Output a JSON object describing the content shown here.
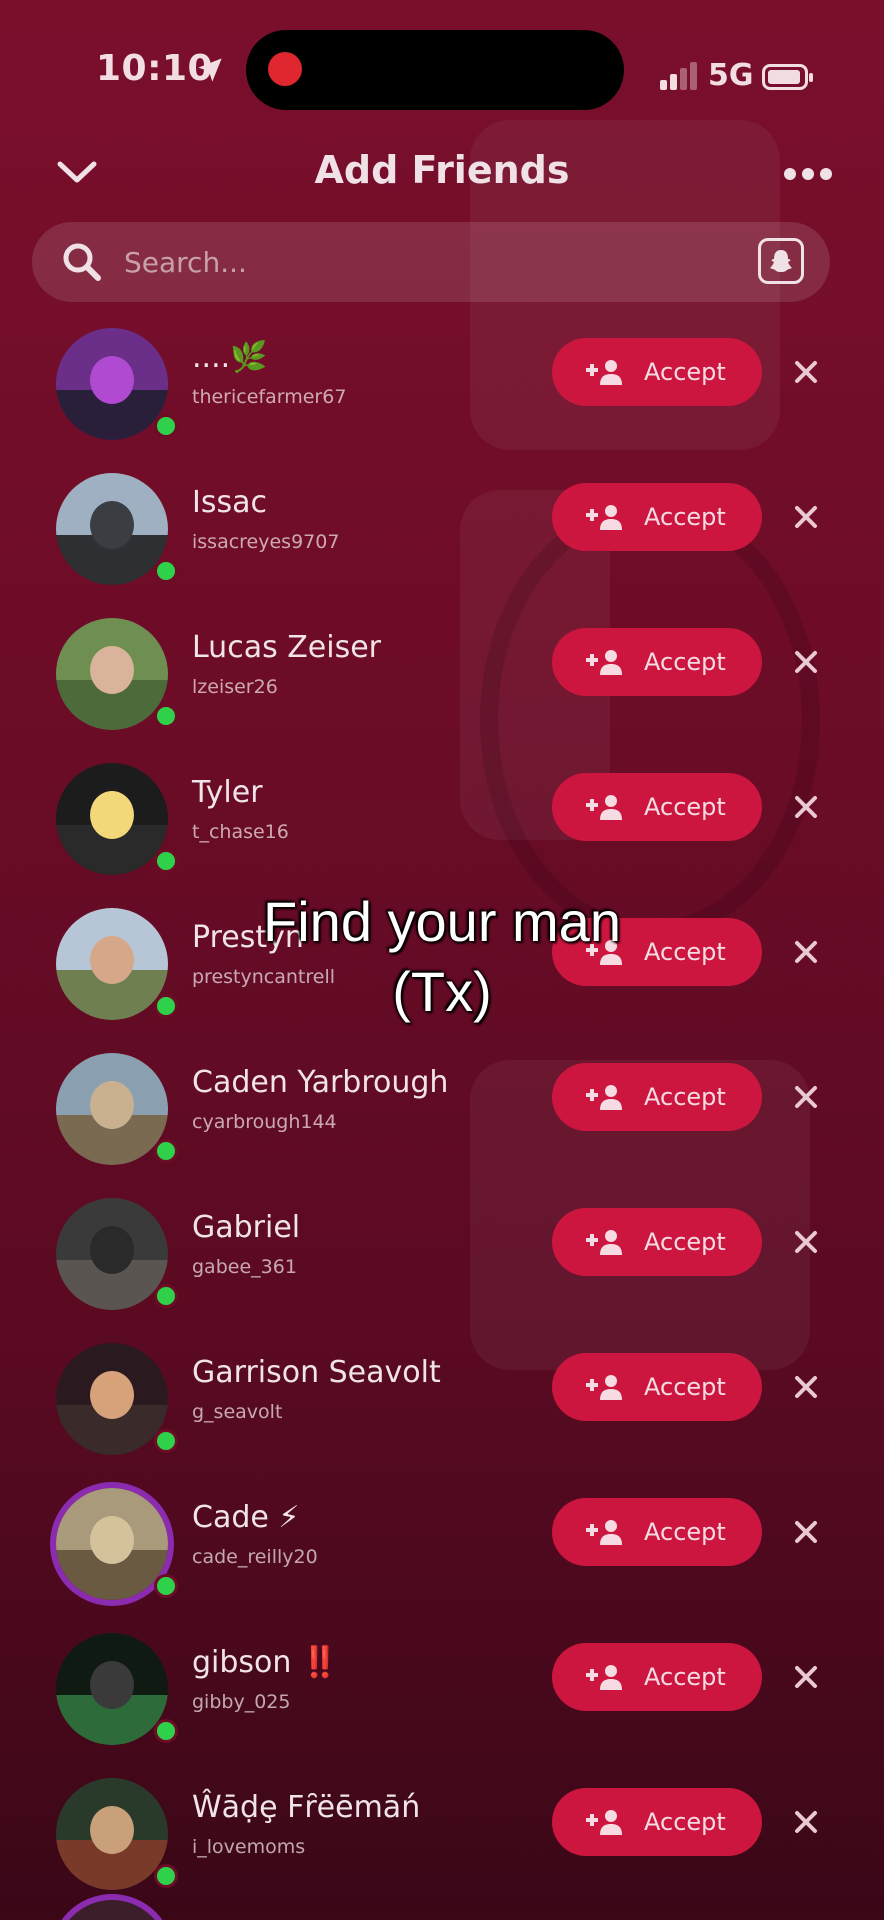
{
  "status_bar": {
    "time": "10:10",
    "network": "5G"
  },
  "header": {
    "title": "Add Friends"
  },
  "search": {
    "placeholder": "Search..."
  },
  "button_labels": {
    "accept": "Accept"
  },
  "caption": {
    "line1": "Find your man",
    "line2": "(Tx)"
  },
  "friends": [
    {
      "name": "....🌿",
      "username": "thericefarmer67",
      "avatar_colors": [
        "#6b2f8a",
        "#2a1f3a",
        "#b04ad0"
      ]
    },
    {
      "name": "Issac",
      "username": "issacreyes9707",
      "avatar_colors": [
        "#9fb0c2",
        "#2d2f33",
        "#3a3d42"
      ]
    },
    {
      "name": "Lucas Zeiser",
      "username": "lzeiser26",
      "avatar_colors": [
        "#6f8f52",
        "#4d6a3a",
        "#d9b49a"
      ]
    },
    {
      "name": "Tyler",
      "username": "t_chase16",
      "avatar_colors": [
        "#1c1c1c",
        "#2a2a2a",
        "#f2d878"
      ]
    },
    {
      "name": "Prestyn",
      "username": "prestyncantrell",
      "avatar_colors": [
        "#b7c6d6",
        "#6f7f52",
        "#d7a78a"
      ]
    },
    {
      "name": "Caden Yarbrough",
      "username": "cyarbrough144",
      "avatar_colors": [
        "#8aa0b0",
        "#7a6a52",
        "#c9b18f"
      ]
    },
    {
      "name": "Gabriel",
      "username": "gabee_361",
      "avatar_colors": [
        "#3a3a3a",
        "#5a5550",
        "#2a2a2a"
      ]
    },
    {
      "name": "Garrison Seavolt",
      "username": "g_seavolt",
      "avatar_colors": [
        "#2a1a1f",
        "#3a2a2a",
        "#d7a27a"
      ]
    },
    {
      "name": "Cade ⚡",
      "username": "cade_reilly20",
      "avatar_colors": [
        "#a89a7a",
        "#6a5a42",
        "#d4c39a"
      ]
    },
    {
      "name": "gibson ‼️",
      "username": "gibby_025",
      "avatar_colors": [
        "#0f1a12",
        "#2d6b3a",
        "#3a3a3a"
      ]
    },
    {
      "name": "Ŵāḍȩ Fȓëēmāń",
      "username": "i_lovemoms",
      "avatar_colors": [
        "#2a3a2a",
        "#7a3a2a",
        "#c9a07a"
      ]
    }
  ]
}
